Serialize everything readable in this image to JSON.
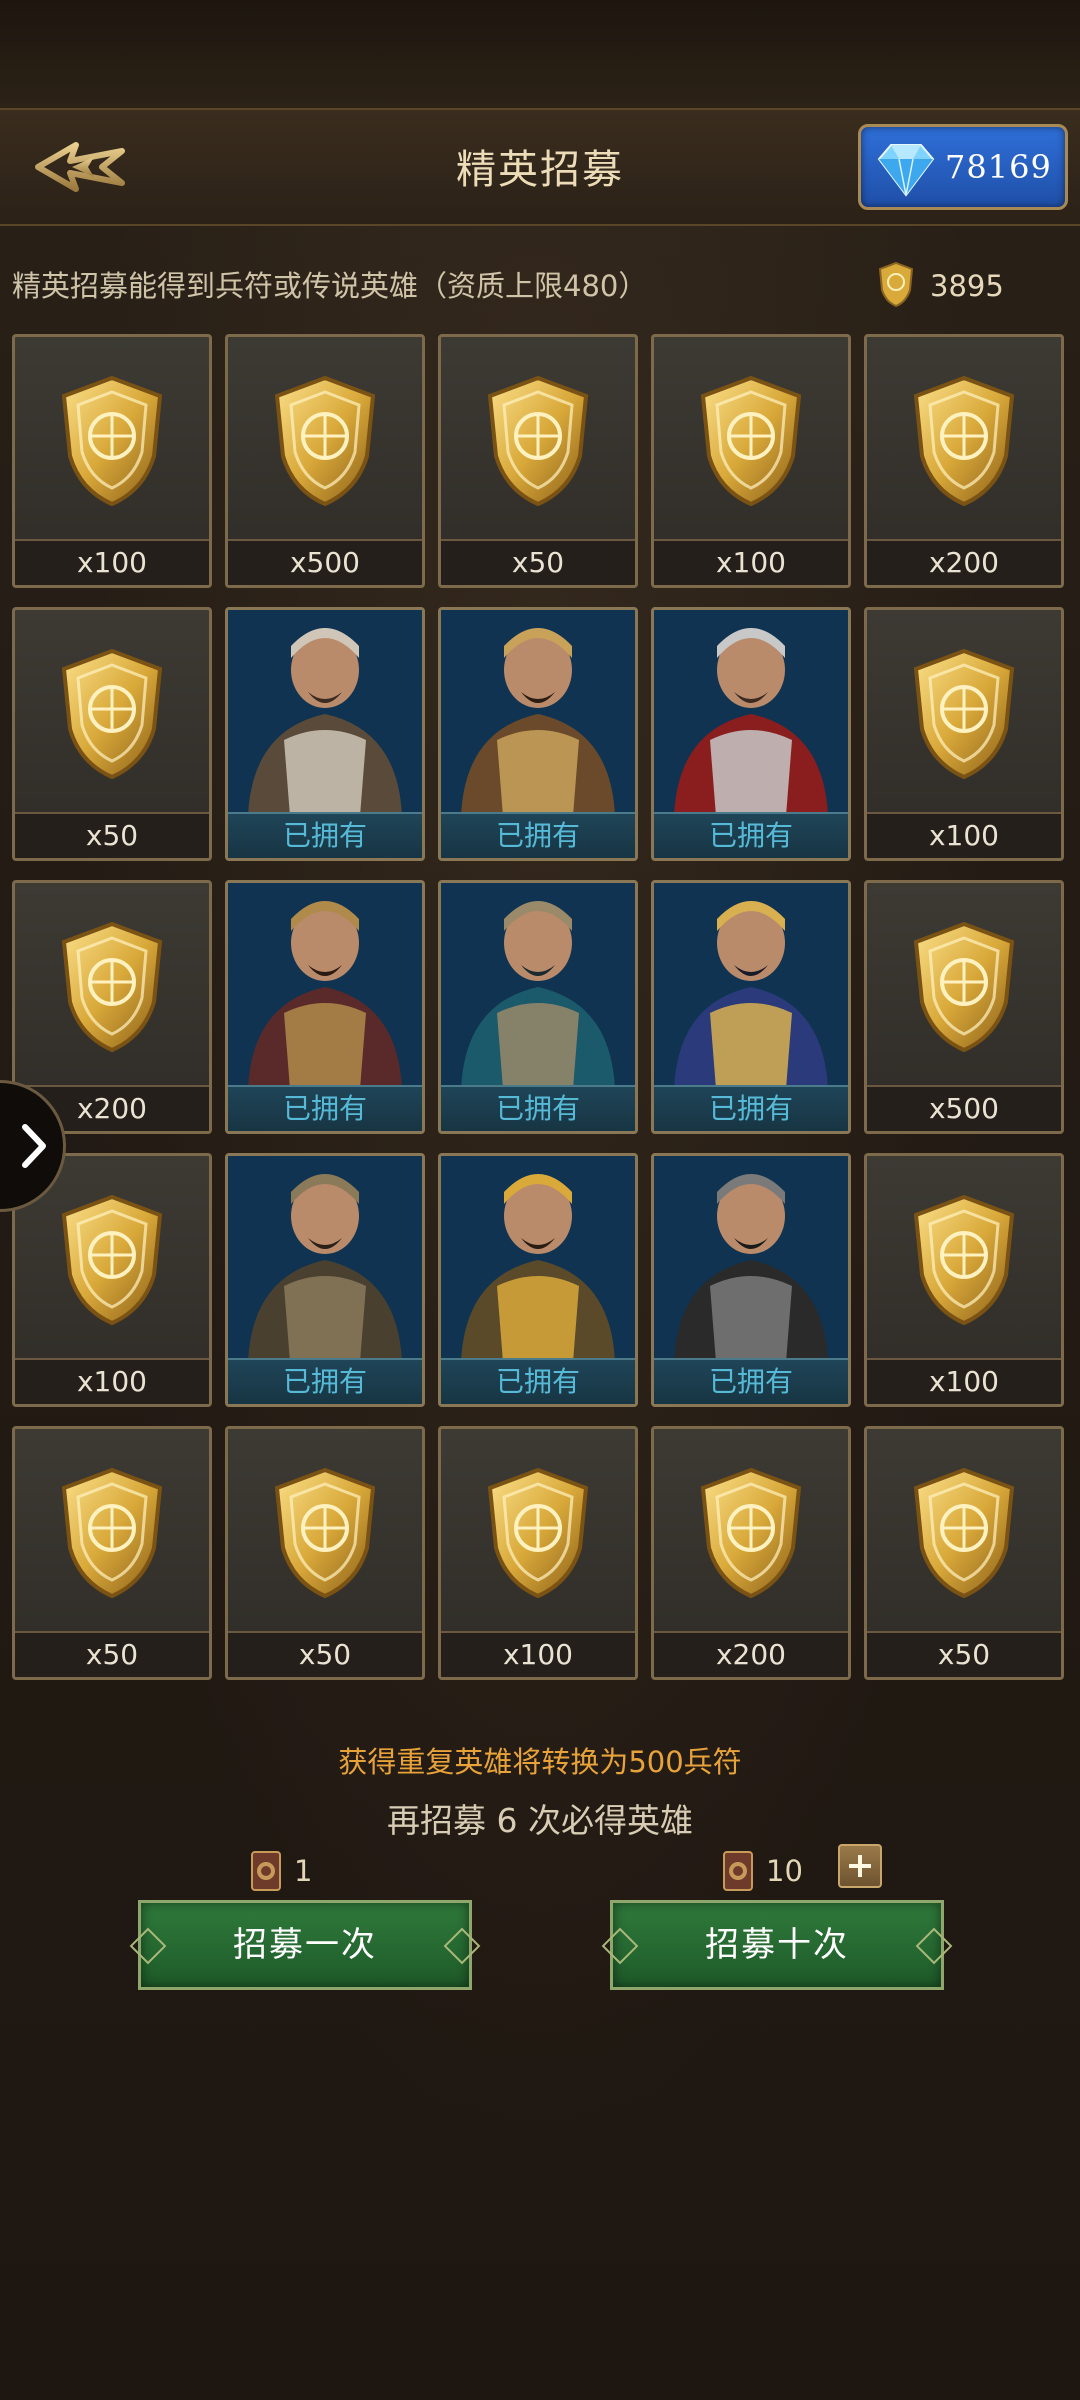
{
  "header": {
    "title": "精英招募",
    "gems": "78169"
  },
  "subheader": {
    "description": "精英招募能得到兵符或传说英雄（资质上限480）",
    "token_count": "3895"
  },
  "grid": [
    [
      {
        "type": "token",
        "label": "x100"
      },
      {
        "type": "token",
        "label": "x500"
      },
      {
        "type": "token",
        "label": "x50"
      },
      {
        "type": "token",
        "label": "x100"
      },
      {
        "type": "token",
        "label": "x200"
      }
    ],
    [
      {
        "type": "token",
        "label": "x50"
      },
      {
        "type": "hero",
        "label": "已拥有",
        "hero_style": "fur-cloak-warrior"
      },
      {
        "type": "hero",
        "label": "已拥有",
        "hero_style": "archer"
      },
      {
        "type": "hero",
        "label": "已拥有",
        "hero_style": "crusader"
      },
      {
        "type": "token",
        "label": "x100"
      }
    ],
    [
      {
        "type": "token",
        "label": "x200"
      },
      {
        "type": "hero",
        "label": "已拥有",
        "hero_style": "crowned-king"
      },
      {
        "type": "hero",
        "label": "已拥有",
        "hero_style": "caped-general"
      },
      {
        "type": "hero",
        "label": "已拥有",
        "hero_style": "pharaoh"
      },
      {
        "type": "token",
        "label": "x500"
      }
    ],
    [
      {
        "type": "token",
        "label": "x100"
      },
      {
        "type": "hero",
        "label": "已拥有",
        "hero_style": "mongol-warrior"
      },
      {
        "type": "hero",
        "label": "已拥有",
        "hero_style": "golden-helmet-archer"
      },
      {
        "type": "hero",
        "label": "已拥有",
        "hero_style": "spear-general"
      },
      {
        "type": "token",
        "label": "x100"
      }
    ],
    [
      {
        "type": "token",
        "label": "x50"
      },
      {
        "type": "token",
        "label": "x50"
      },
      {
        "type": "token",
        "label": "x100"
      },
      {
        "type": "token",
        "label": "x200"
      },
      {
        "type": "token",
        "label": "x50"
      }
    ]
  ],
  "footer": {
    "notice": "获得重复英雄将转换为500兵符",
    "pity": "再招募 6 次必得英雄",
    "single": {
      "cost": "1",
      "label": "招募一次"
    },
    "ten": {
      "cost": "10",
      "label": "招募十次"
    }
  },
  "colors": {
    "accent_gold": "#d9a93a",
    "notice_orange": "#e8a23a",
    "owned_cyan": "#56b9d6",
    "button_green": "#2f7a3b",
    "gem_blue": "#2f6fd8"
  },
  "icons": {
    "back": "back-arrow-icon",
    "gem": "diamond-icon",
    "token": "shield-token-icon",
    "scroll": "recruit-scroll-icon",
    "side": "chevron-right-icon"
  }
}
